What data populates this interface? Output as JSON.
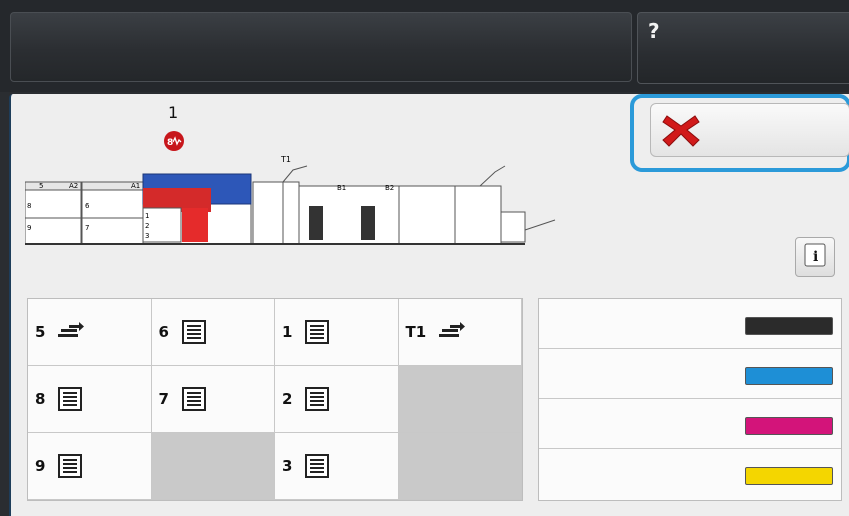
{
  "header": {
    "title": "",
    "help_icon": "question-icon",
    "help_glyph": "?"
  },
  "alert": {
    "count": "1",
    "icon": "fault-icon"
  },
  "machine": {
    "labels": [
      "5",
      "A2",
      "A1",
      "8",
      "6",
      "9",
      "7",
      "1",
      "2",
      "3",
      "T1",
      "B1",
      "B2"
    ]
  },
  "cancel": {
    "icon": "close-icon",
    "color": "#d11a1a"
  },
  "info": {
    "icon": "info-icon",
    "glyph": "i"
  },
  "trays": [
    {
      "label": "5",
      "icon": "bypass-tray-icon"
    },
    {
      "label": "6",
      "icon": "paper-stack-icon"
    },
    {
      "label": "1",
      "icon": "paper-stack-icon"
    },
    {
      "label": "T1",
      "icon": "bypass-tray-icon"
    },
    {
      "label": "8",
      "icon": "paper-stack-icon"
    },
    {
      "label": "7",
      "icon": "paper-stack-icon"
    },
    {
      "label": "2",
      "icon": "paper-stack-icon"
    },
    {
      "label": "",
      "icon": ""
    },
    {
      "label": "9",
      "icon": "paper-stack-icon"
    },
    {
      "label": "",
      "icon": ""
    },
    {
      "label": "3",
      "icon": "paper-stack-icon"
    },
    {
      "label": "",
      "icon": ""
    }
  ],
  "supplies": [
    {
      "name": "black",
      "color": "#2b2b2b"
    },
    {
      "name": "cyan",
      "color": "#1e8fd6"
    },
    {
      "name": "magenta",
      "color": "#d3147a"
    },
    {
      "name": "yellow",
      "color": "#f4d600"
    }
  ]
}
